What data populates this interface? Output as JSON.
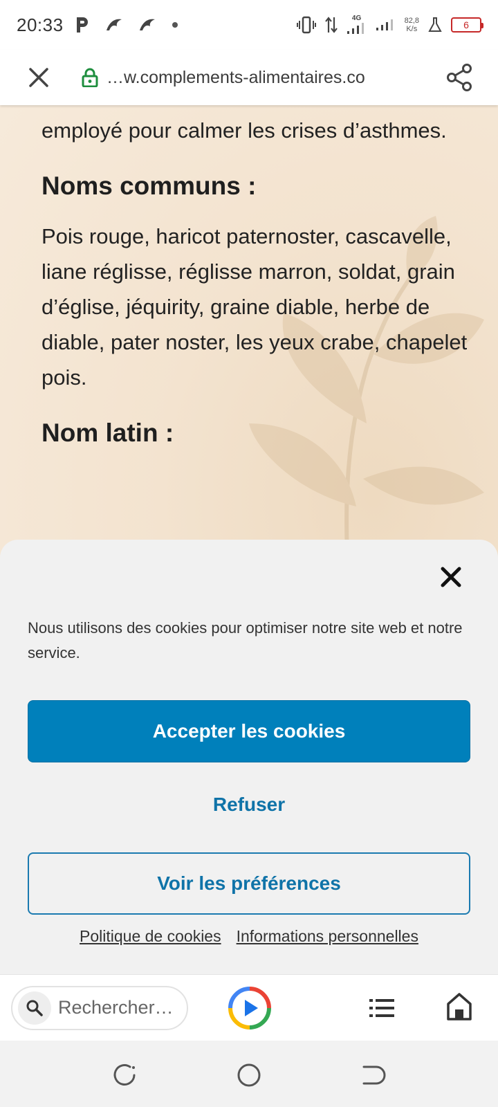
{
  "status_bar": {
    "time": "20:33",
    "network": "4G",
    "net_speed_value": "82,8",
    "net_speed_unit": "K/s",
    "battery": "6",
    "icons": [
      "parking-icon",
      "bird-icon",
      "bird-icon",
      "dot-icon",
      "vibrate-icon",
      "data-arrows-icon",
      "signal-icon",
      "signal-icon",
      "lab-flask-icon",
      "battery-icon"
    ]
  },
  "toolbar": {
    "url": "…w.complements-alimentaires.co",
    "close_icon": "close-icon",
    "lock_icon": "lock-icon",
    "share_icon": "share-icon"
  },
  "article": {
    "intro_partial": "est un anti-inflammatoire, il est aussi employé pour calmer les crises d’asthmes.",
    "heading_common": "Noms communs :",
    "common_names": "Pois rouge, haricot paternoster, cascavelle, liane réglisse, réglisse marron, soldat, grain d’église, jéquirity, graine diable, herbe de diable, pater noster, les yeux crabe, chapelet pois.",
    "heading_latin": "Nom latin :"
  },
  "cookie_banner": {
    "message": "Nous utilisons des cookies pour optimiser notre site web et notre service.",
    "accept_label": "Accepter les cookies",
    "refuse_label": "Refuser",
    "preferences_label": "Voir les préférences",
    "link_cookie_policy": "Politique de cookies",
    "link_personal_info": "Informations personnelles",
    "accent_color": "#0080bb"
  },
  "bottom_bar": {
    "search_placeholder": "Rechercher…",
    "icons": [
      "search-icon",
      "play-icon",
      "list-icon",
      "home-icon"
    ]
  },
  "system_nav": {
    "icons": [
      "recent-apps-icon",
      "home-circle-icon",
      "back-icon"
    ]
  }
}
